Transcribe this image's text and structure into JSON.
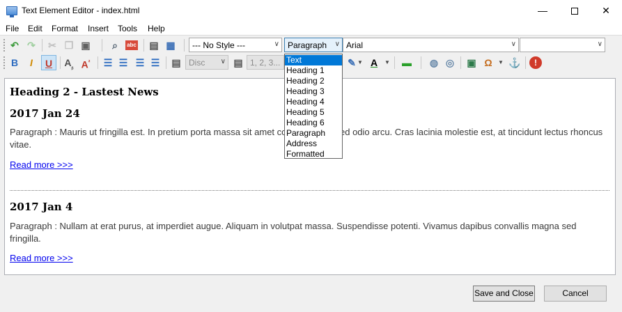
{
  "window": {
    "title": "Text Element Editor - index.html",
    "min_glyph": "—",
    "close_glyph": "✕"
  },
  "menu": [
    "File",
    "Edit",
    "Format",
    "Insert",
    "Tools",
    "Help"
  ],
  "toolbar": {
    "style_combo": "--- No Style ---",
    "block_combo": "Paragraph",
    "font_combo": "Arial",
    "size_combo": "",
    "list_style_combo": "Disc",
    "list_number_combo": "1, 2, 3..."
  },
  "block_dropdown": {
    "options": [
      "Text",
      "Heading 1",
      "Heading 2",
      "Heading 3",
      "Heading 4",
      "Heading 5",
      "Heading 6",
      "Paragraph",
      "Address",
      "Formatted"
    ],
    "highlighted": "Text"
  },
  "content": {
    "heading_main": "Heading 2 - Lastest News",
    "entry1_date": "2017 Jan 24",
    "entry1_text": "Paragraph : Mauris ut fringilla est. In pretium porta massa sit amet congue. Proin sed odio arcu. Cras lacinia molestie est, at tincidunt lectus rhoncus vitae.",
    "entry1_link": "Read more >>>",
    "entry2_date": "2017 Jan 4",
    "entry2_text": "Paragraph : Nullam at erat purus, at imperdiet augue. Aliquam in volutpat massa. Suspendisse potenti. Vivamus dapibus convallis magna sed fringilla.",
    "entry2_link": "Read more >>>"
  },
  "buttons": {
    "save_close": "Save and Close",
    "cancel": "Cancel"
  },
  "colors": {
    "accent": "#0078d7",
    "link": "#0000ee"
  }
}
